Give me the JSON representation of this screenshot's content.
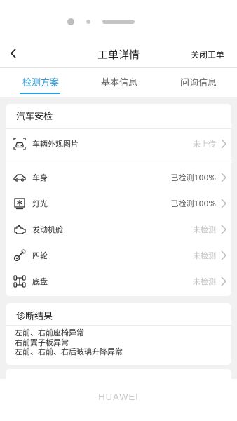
{
  "header": {
    "title": "工单详情",
    "action": "关闭工单"
  },
  "tabs": [
    {
      "label": "检测方案",
      "active": true
    },
    {
      "label": "基本信息",
      "active": false
    },
    {
      "label": "问询信息",
      "active": false
    }
  ],
  "inspection": {
    "title": "汽车安检",
    "photo": {
      "label": "车辆外观图片",
      "status": "未上传",
      "icon": "car-camera-icon"
    },
    "items": [
      {
        "label": "车身",
        "status": "已检测100%",
        "icon": "car-body-icon"
      },
      {
        "label": "灯光",
        "status": "已检测100%",
        "icon": "light-icon"
      },
      {
        "label": "发动机舱",
        "status": "未检测",
        "icon": "engine-icon"
      },
      {
        "label": "四轮",
        "status": "未检测",
        "icon": "wheel-icon"
      },
      {
        "label": "底盘",
        "status": "未检测",
        "icon": "chassis-icon"
      }
    ]
  },
  "diagnosis": {
    "title": "诊断结果",
    "lines": [
      "左前、右前座椅异常",
      "右前翼子板异常",
      "左前、右前、右后玻璃升降异常"
    ]
  },
  "brand": "HUAWEI",
  "colors": {
    "accent": "#2a9ddd",
    "background": "#f1f1f1"
  }
}
